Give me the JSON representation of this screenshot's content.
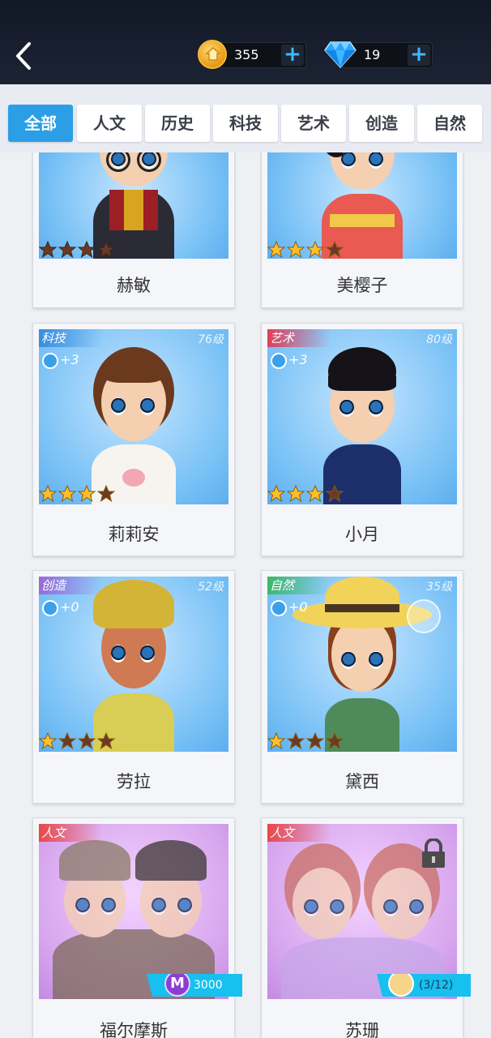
{
  "header": {
    "coins": "355",
    "gems": "19"
  },
  "tabs": [
    "全部",
    "人文",
    "历史",
    "科技",
    "艺术",
    "创造",
    "自然"
  ],
  "cards": [
    {
      "name": "赫敏",
      "category": "",
      "level": "",
      "bonus": "",
      "stars": 0
    },
    {
      "name": "美樱子",
      "category": "",
      "level": "",
      "bonus": "",
      "stars": 3
    },
    {
      "name": "莉莉安",
      "category": "科技",
      "level": "76级",
      "bonus": "+3",
      "stars": 3
    },
    {
      "name": "小月",
      "category": "艺术",
      "level": "80级",
      "bonus": "+3",
      "stars": 3
    },
    {
      "name": "劳拉",
      "category": "创造",
      "level": "52级",
      "bonus": "+0",
      "stars": 1
    },
    {
      "name": "黛西",
      "category": "自然",
      "level": "35级",
      "bonus": "+0",
      "stars": 1
    },
    {
      "name": "福尔摩斯",
      "category": "人文",
      "price": "3000",
      "price_icon": "M"
    },
    {
      "name": "苏珊",
      "category": "人文",
      "progress": "(3/12)"
    }
  ],
  "colors": {
    "accent": "#2c9ee6",
    "tech": "#3a8de0",
    "art": "#e0405a",
    "create": "#9b6ad8",
    "nature": "#3fb86a",
    "humanities": "#e84848"
  }
}
